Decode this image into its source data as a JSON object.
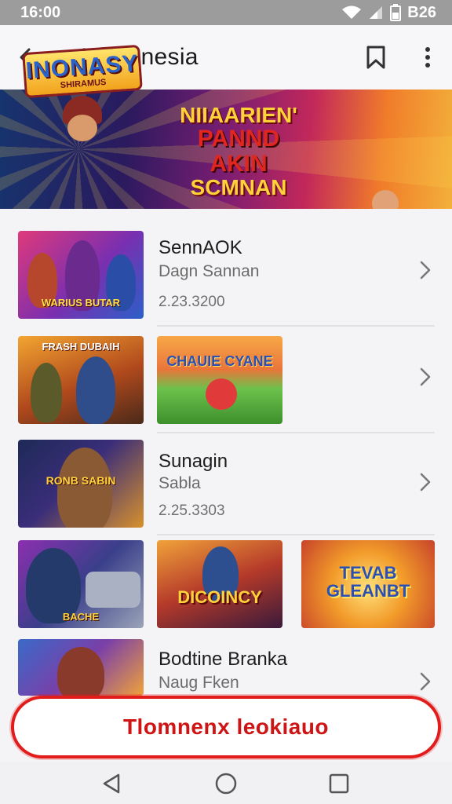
{
  "status_bar": {
    "time": "16:00",
    "battery_text": "B26",
    "icons": [
      "wifi-icon",
      "signal-icon",
      "battery-icon"
    ]
  },
  "app_bar": {
    "title": "Indaonesia",
    "icons": [
      "back-arrow-icon",
      "bookmark-icon",
      "more-vert-icon"
    ]
  },
  "banner": {
    "logo_main": "INONASY",
    "logo_sub": "SHIRAMUS",
    "title_line1": "NIIAARIEN'",
    "title_line2": "PANND AKIN",
    "title_line3": "SCMNAN"
  },
  "list": {
    "items": [
      {
        "title": "SennAOK",
        "subtitle": "Dagn Sannan",
        "meta": "2.23.3200",
        "thumbs": [
          {
            "label": "WARIUS BUTAR"
          }
        ]
      },
      {
        "title": "",
        "subtitle": "",
        "meta": "",
        "thumbs": [
          {
            "label": "FRASH DUBAIH"
          },
          {
            "label": "CHAUIE CYANE"
          }
        ]
      },
      {
        "title": "Sunagin",
        "subtitle": "Sabla",
        "meta": "2.25.3303",
        "thumbs": [
          {
            "label": "RONB SABIN"
          }
        ]
      },
      {
        "title": "",
        "subtitle": "",
        "meta": "",
        "thumbs": [
          {
            "label": "BACHE"
          },
          {
            "label": "DICOINCY"
          },
          {
            "label": "TEVAB GLEANBT"
          }
        ]
      },
      {
        "title": "Bodtine Branka",
        "subtitle": "Naug Fken",
        "meta": "",
        "thumbs": [
          {
            "label": ""
          }
        ]
      }
    ]
  },
  "cta": {
    "label": "Tlomnenx leokiauo"
  },
  "nav_bar": {
    "icons": [
      "nav-back-icon",
      "nav-home-icon",
      "nav-recents-icon"
    ]
  },
  "colors": {
    "accent": "#e21b1b",
    "status_bar": "#9c9c9c",
    "background": "#f4f4f6"
  }
}
